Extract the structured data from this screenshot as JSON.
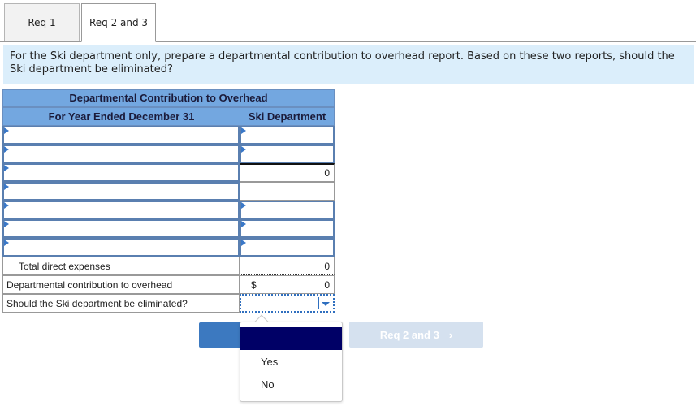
{
  "tabs": [
    {
      "label": "Req 1",
      "active": false
    },
    {
      "label": "Req 2 and 3",
      "active": true
    }
  ],
  "instructions": "For the Ski department only, prepare a departmental contribution to overhead report. Based on these two reports, should the Ski department be eliminated?",
  "report": {
    "title": "Departmental Contribution to Overhead",
    "period_label": "For Year Ended December 31",
    "column_header": "Ski Department",
    "rows": [
      {
        "label": "",
        "value": ""
      },
      {
        "label": "",
        "value": ""
      },
      {
        "label": "",
        "value": "0"
      },
      {
        "label": "",
        "value": ""
      },
      {
        "label": "",
        "value": ""
      },
      {
        "label": "",
        "value": ""
      },
      {
        "label": "",
        "value": ""
      }
    ],
    "total_direct_expenses": {
      "label": "Total direct expenses",
      "value": "0"
    },
    "contribution": {
      "label": "Departmental contribution to overhead",
      "currency": "$",
      "value": "0"
    },
    "eliminate_question": {
      "label": "Should the Ski department be eliminated?",
      "selected": ""
    }
  },
  "dropdown": {
    "options": [
      "",
      "Yes",
      "No"
    ]
  },
  "nav": {
    "prev_label": "",
    "next_label": "Req 2 and 3",
    "next_icon": "chevron-right-icon"
  }
}
